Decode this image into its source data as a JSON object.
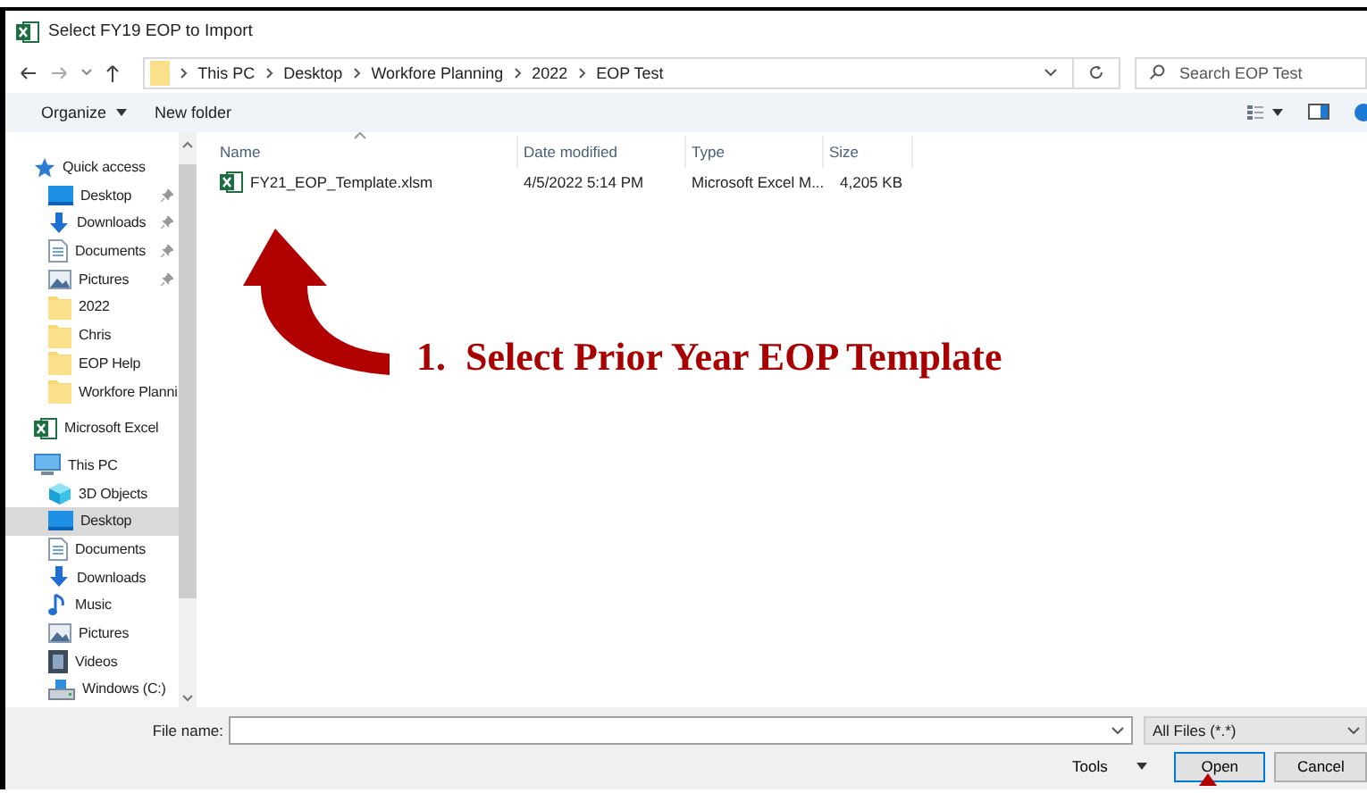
{
  "window": {
    "title": "Select FY19 EOP to Import"
  },
  "address_bar": {
    "path": [
      "This PC",
      "Desktop",
      "Workfore Planning",
      "2022",
      "EOP Test"
    ],
    "search": {
      "placeholder": "Search EOP Test"
    }
  },
  "toolbar": {
    "organize": "Organize",
    "new_folder": "New folder"
  },
  "navigation": [
    {
      "label": "Quick access",
      "kind": "star",
      "selected": false,
      "children": [
        {
          "label": "Desktop",
          "kind": "desktop",
          "pinned": true,
          "selected": false
        },
        {
          "label": "Downloads",
          "kind": "download",
          "pinned": true,
          "selected": false
        },
        {
          "label": "Documents",
          "kind": "document",
          "pinned": true,
          "selected": false
        },
        {
          "label": "Pictures",
          "kind": "pictures",
          "pinned": true,
          "selected": false
        },
        {
          "label": "2022",
          "kind": "folder",
          "pinned": false,
          "selected": false
        },
        {
          "label": "Chris",
          "kind": "folder",
          "pinned": false,
          "selected": false
        },
        {
          "label": "EOP Help",
          "kind": "folder",
          "pinned": false,
          "selected": false
        },
        {
          "label": "Workfore Planni",
          "kind": "folder",
          "pinned": false,
          "selected": false
        }
      ]
    },
    {
      "label": "Microsoft Excel",
      "kind": "excel",
      "selected": false
    },
    {
      "label": "This PC",
      "kind": "pc",
      "selected": false,
      "children": [
        {
          "label": "3D Objects",
          "kind": "cube",
          "pinned": false,
          "selected": false
        },
        {
          "label": "Desktop",
          "kind": "desktop",
          "pinned": false,
          "selected": true
        },
        {
          "label": "Documents",
          "kind": "document",
          "pinned": false,
          "selected": false
        },
        {
          "label": "Downloads",
          "kind": "download",
          "pinned": false,
          "selected": false
        },
        {
          "label": "Music",
          "kind": "music",
          "pinned": false,
          "selected": false
        },
        {
          "label": "Pictures",
          "kind": "pictures",
          "pinned": false,
          "selected": false
        },
        {
          "label": "Videos",
          "kind": "video",
          "pinned": false,
          "selected": false
        },
        {
          "label": "Windows (C:)",
          "kind": "drive",
          "pinned": false,
          "selected": false
        }
      ]
    }
  ],
  "file_list": {
    "columns": [
      "Name",
      "Date modified",
      "Type",
      "Size"
    ],
    "rows": [
      {
        "kind": "excel",
        "selected": false,
        "cells": [
          "FY21_EOP_Template.xlsm",
          "4/5/2022 5:14 PM",
          "Microsoft Excel M...",
          "4,205 KB"
        ]
      }
    ]
  },
  "annotation": {
    "text": "1.  Select Prior Year EOP Template"
  },
  "footer": {
    "file_name_label": "File name:",
    "filter": "All Files (*.*)",
    "tools": "Tools",
    "buttons": [
      {
        "label": "Open",
        "default": true
      },
      {
        "label": "Cancel",
        "default": false
      }
    ]
  }
}
